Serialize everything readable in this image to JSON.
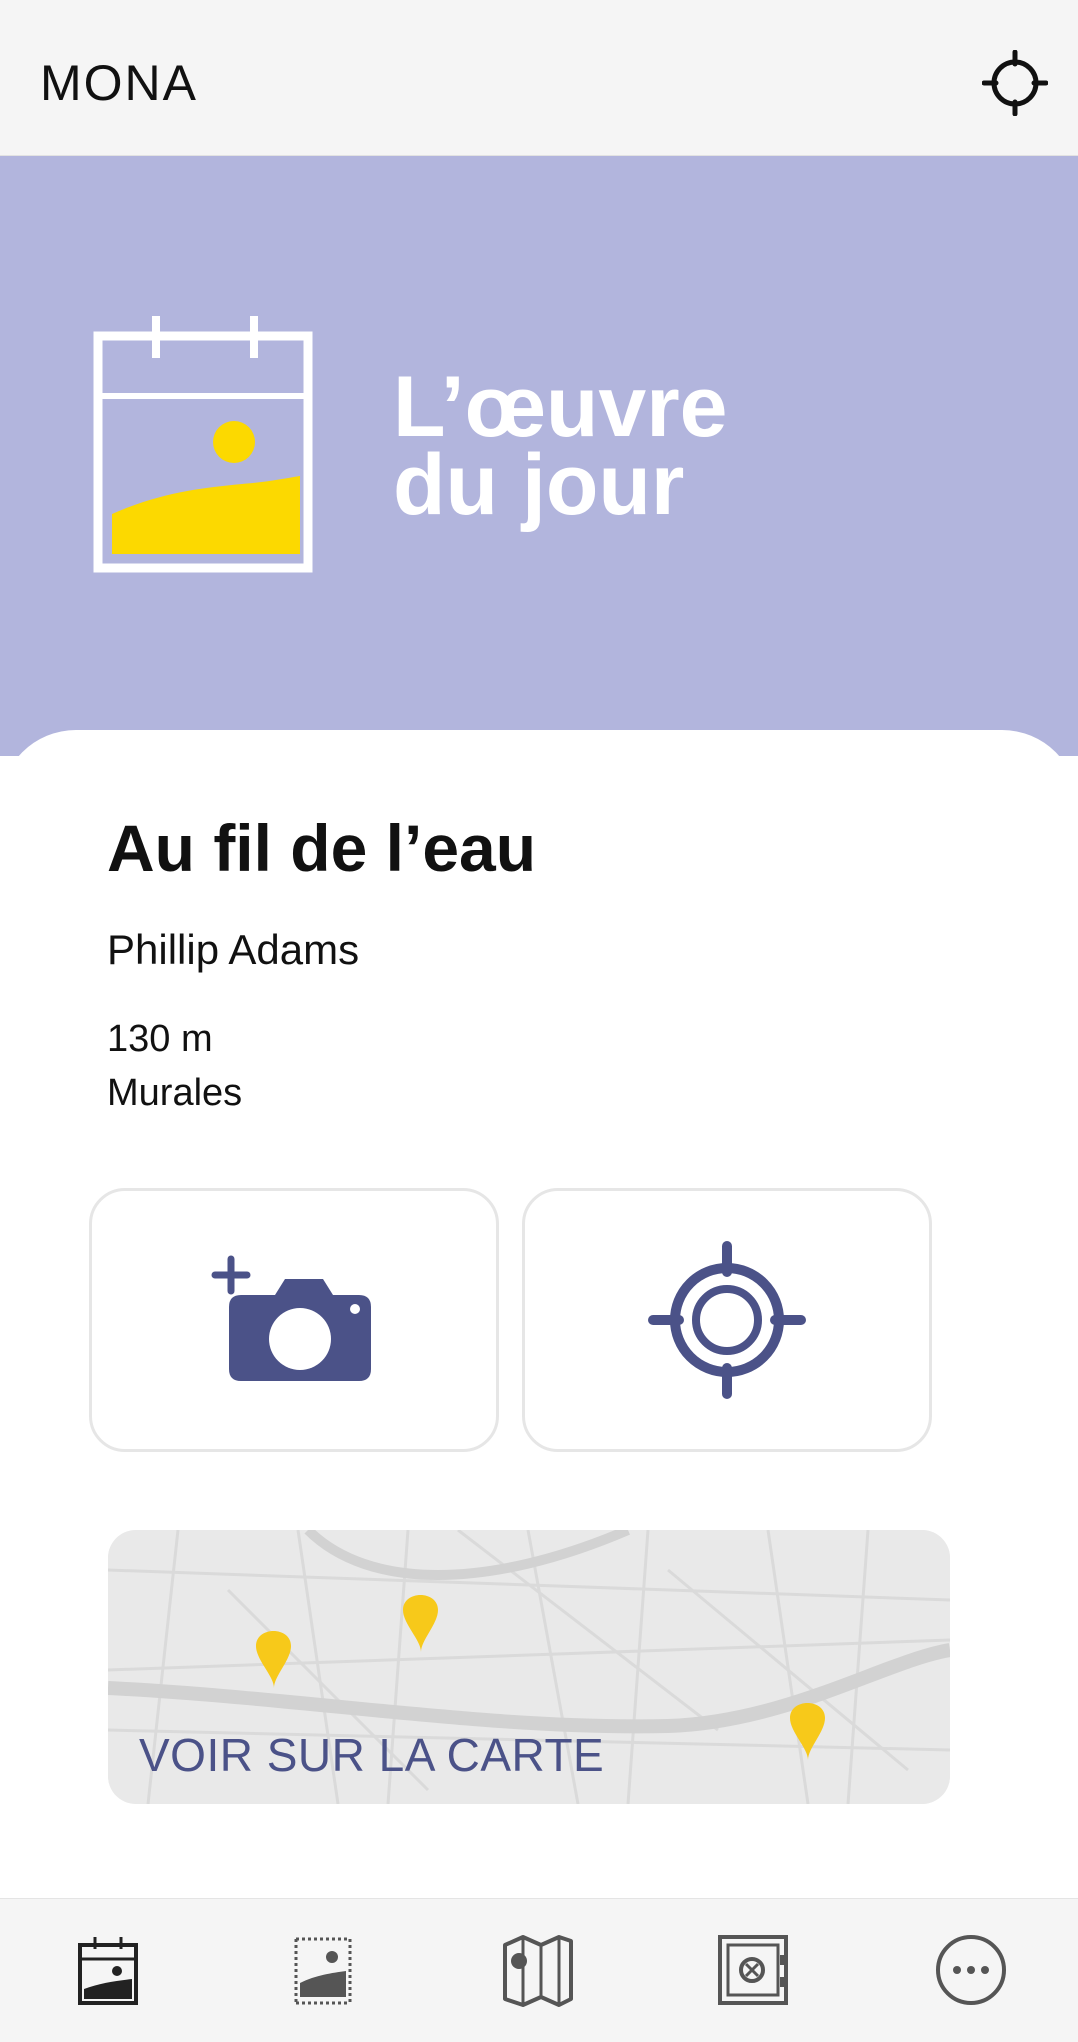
{
  "header": {
    "app_title": "MONA",
    "locate_icon": "crosshair-icon"
  },
  "hero": {
    "title_line1": "L’œuvre",
    "title_line2": "du jour",
    "icon": "calendar-artwork-icon",
    "background_color": "#b2b5dd"
  },
  "artwork": {
    "title": "Au fil de l’eau",
    "artist": "Phillip Adams",
    "distance": "130 m",
    "category": "Murales"
  },
  "actions": {
    "photo_icon": "add-photo-camera-icon",
    "target_icon": "target-icon",
    "accent_color": "#4b5288"
  },
  "map": {
    "label": "VOIR SUR LA CARTE",
    "pin_color": "#f7c91a"
  },
  "bottom_nav": {
    "items": [
      {
        "icon": "artwork-of-day-icon"
      },
      {
        "icon": "collection-icon"
      },
      {
        "icon": "map-icon"
      },
      {
        "icon": "badges-safe-icon"
      },
      {
        "icon": "more-icon"
      }
    ]
  }
}
